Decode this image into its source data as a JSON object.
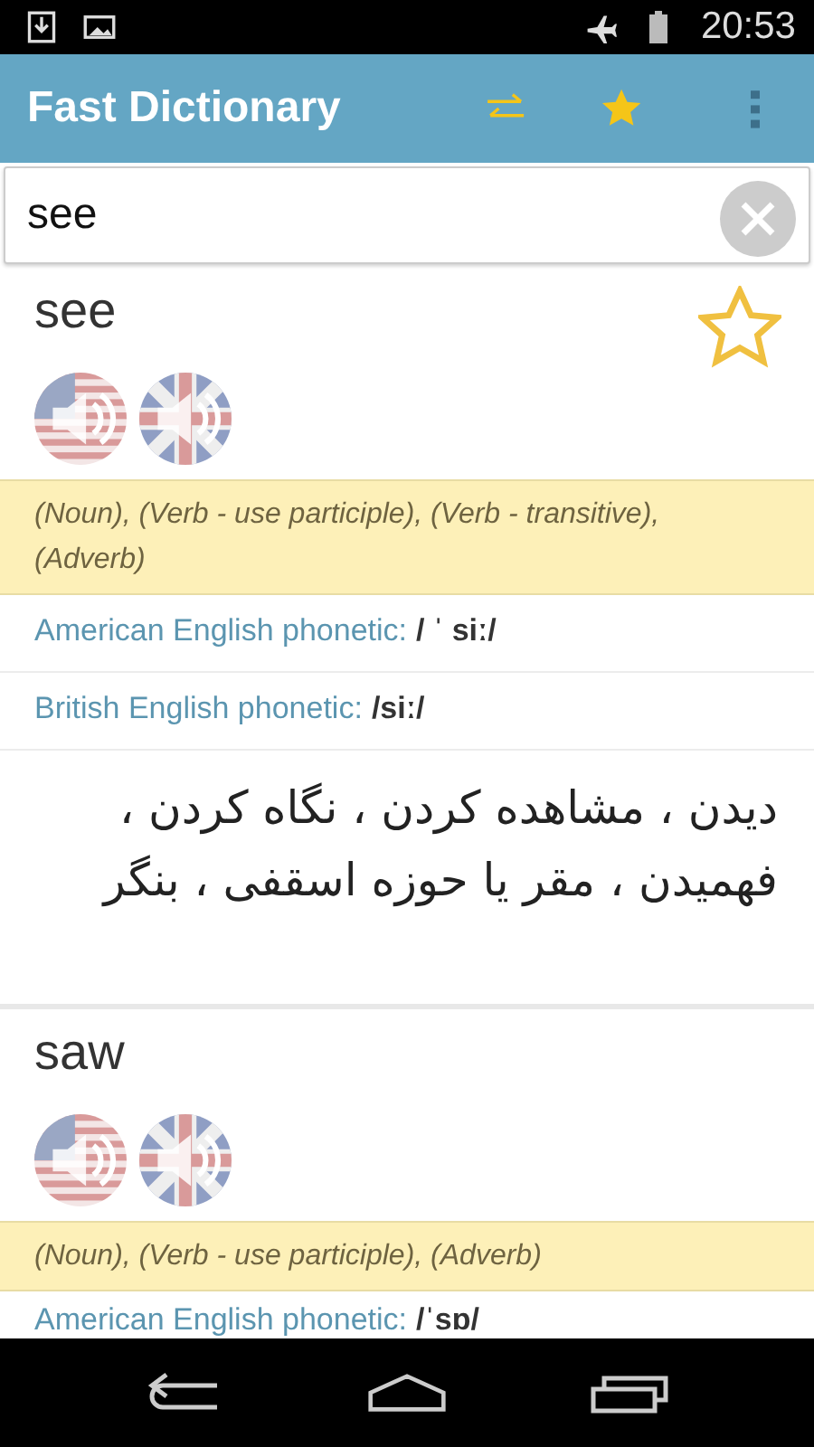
{
  "status_bar": {
    "time": "20:53"
  },
  "app_bar": {
    "title": "Fast Dictionary"
  },
  "search": {
    "value": "see"
  },
  "entries": [
    {
      "word": "see",
      "favorite": false,
      "parts_of_speech": "(Noun), (Verb - use participle), (Verb - transitive), (Adverb)",
      "phonetics": [
        {
          "label": "American English phonetic:",
          "value": "/ ˈ siː/"
        },
        {
          "label": "British English phonetic:",
          "value": "/siː/"
        }
      ],
      "translation": "دیدن ، مشاهده کردن ، نگاه کردن ، فهمیدن ، مقر یا حوزه اسقفی ، بنگر"
    },
    {
      "word": "saw",
      "parts_of_speech": "(Noun), (Verb - use participle), (Adverb)",
      "phonetics": [
        {
          "label": "American English phonetic:",
          "value": "/ˈsɒ/"
        }
      ]
    }
  ]
}
